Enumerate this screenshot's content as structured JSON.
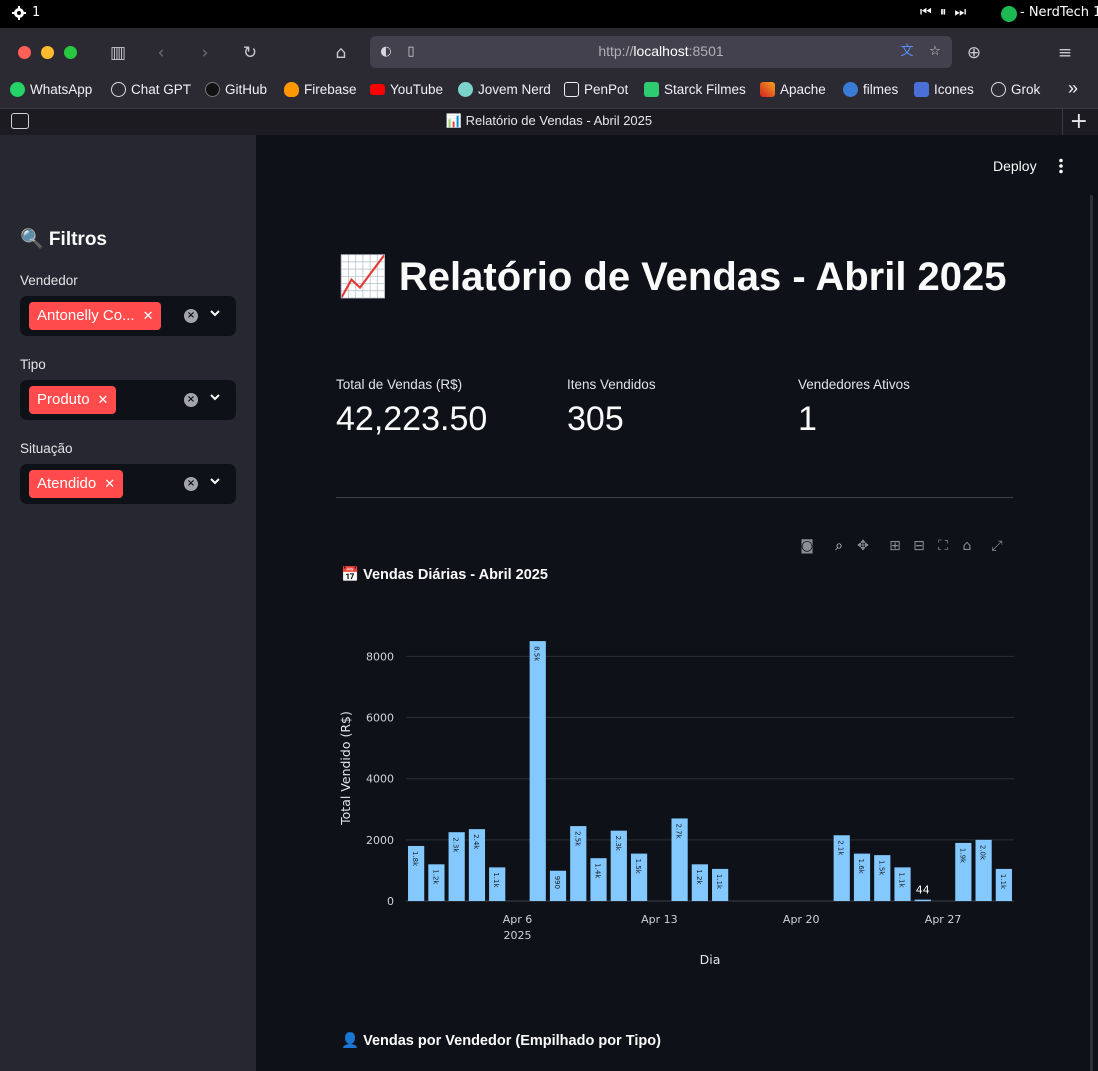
{
  "os_menubar": {
    "item_count": "1",
    "now_playing": "- NerdTech 1"
  },
  "browser": {
    "url_scheme": "http://",
    "url_host": "localhost",
    "url_port": ":8501",
    "tab_title": "📊 Relatório de Vendas - Abril 2025",
    "bookmarks": [
      "WhatsApp",
      "Chat GPT",
      "GitHub",
      "Firebase",
      "YouTube",
      "Jovem Nerd",
      "PenPot",
      "Starck Filmes",
      "Apache",
      "filmes",
      "Icones",
      "Grok"
    ],
    "overflow": "»"
  },
  "toolbar": {
    "deploy_label": "Deploy"
  },
  "sidebar": {
    "title": "🔍 Filtros",
    "filters": [
      {
        "label": "Vendedor",
        "chip": "Antonelly Co..."
      },
      {
        "label": "Tipo",
        "chip": "Produto"
      },
      {
        "label": "Situação",
        "chip": "Atendido"
      }
    ]
  },
  "main": {
    "title": "📈 Relatório de Vendas - Abril 2025",
    "metrics": [
      {
        "label": "Total de Vendas (R$)",
        "value": "42,223.50"
      },
      {
        "label": "Itens Vendidos",
        "value": "305"
      },
      {
        "label": "Vendedores Ativos",
        "value": "1"
      }
    ],
    "chart_title": "📅 Vendas Diárias - Abril 2025",
    "section2_title": "👤 Vendas por Vendedor (Empilhado por Tipo)"
  },
  "colors": {
    "bar": "#83c9ff",
    "accent": "#ff4b4b",
    "sidebar_bg": "#262730",
    "app_bg": "#0e1117"
  },
  "chart_data": {
    "type": "bar",
    "title": "📅 Vendas Diárias - Abril 2025",
    "xlabel": "Dia",
    "ylabel": "Total Vendido (R$)",
    "ylim": [
      0,
      8700
    ],
    "yticks": [
      0,
      2000,
      4000,
      6000,
      8000
    ],
    "xticks": [
      {
        "day": 6,
        "label": "Apr 6",
        "sub": "2025"
      },
      {
        "day": 13,
        "label": "Apr 13",
        "sub": ""
      },
      {
        "day": 20,
        "label": "Apr 20",
        "sub": ""
      },
      {
        "day": 27,
        "label": "Apr 27",
        "sub": ""
      }
    ],
    "grid": true,
    "points": [
      {
        "day": 1,
        "value": 1800,
        "label": "1.8k"
      },
      {
        "day": 2,
        "value": 1200,
        "label": "1.2k"
      },
      {
        "day": 3,
        "value": 2250,
        "label": "2.3k"
      },
      {
        "day": 4,
        "value": 2350,
        "label": "2.4k"
      },
      {
        "day": 5,
        "value": 1100,
        "label": "1.1k"
      },
      {
        "day": 7,
        "value": 8500,
        "label": "8.5k"
      },
      {
        "day": 8,
        "value": 990,
        "label": "990"
      },
      {
        "day": 9,
        "value": 2450,
        "label": "2.5k"
      },
      {
        "day": 10,
        "value": 1400,
        "label": "1.4k"
      },
      {
        "day": 11,
        "value": 2300,
        "label": "2.3k"
      },
      {
        "day": 12,
        "value": 1550,
        "label": "1.5k"
      },
      {
        "day": 14,
        "value": 2700,
        "label": "2.7k"
      },
      {
        "day": 15,
        "value": 1200,
        "label": "1.2k"
      },
      {
        "day": 16,
        "value": 1050,
        "label": "1.1k"
      },
      {
        "day": 22,
        "value": 2150,
        "label": "2.1k"
      },
      {
        "day": 23,
        "value": 1550,
        "label": "1.6k"
      },
      {
        "day": 24,
        "value": 1500,
        "label": "1.5k"
      },
      {
        "day": 25,
        "value": 1100,
        "label": "1.1k"
      },
      {
        "day": 26,
        "value": 44,
        "label": "44"
      },
      {
        "day": 28,
        "value": 1900,
        "label": "1.9k"
      },
      {
        "day": 29,
        "value": 2000,
        "label": "2.0k"
      },
      {
        "day": 30,
        "value": 1050,
        "label": "1.1k"
      }
    ]
  }
}
